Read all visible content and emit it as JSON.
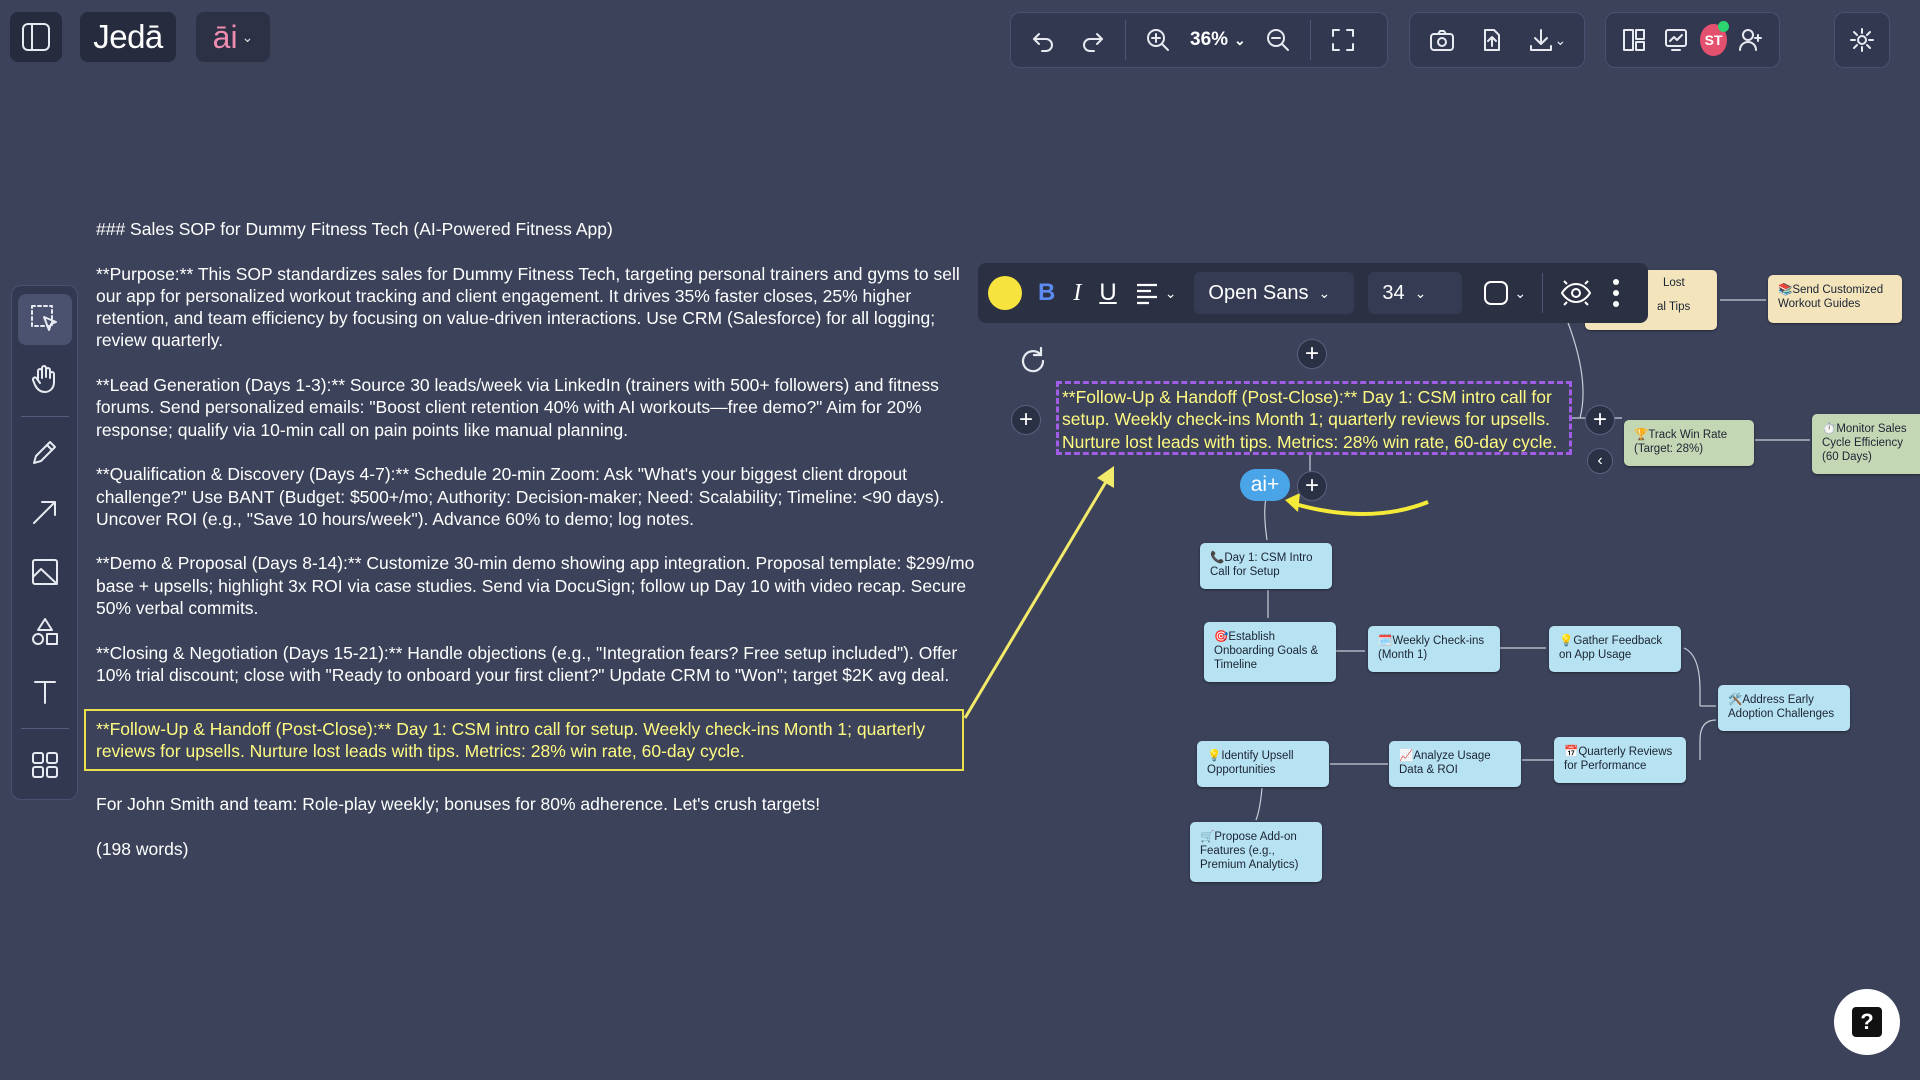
{
  "app": {
    "brand": "Jedā",
    "ai_label": "āi"
  },
  "toolbar": {
    "zoom": "36%",
    "avatar_initials": "ST"
  },
  "format_bar": {
    "color": "#f7e33e",
    "bold": "B",
    "italic": "I",
    "underline": "U",
    "font": "Open Sans",
    "size": "34"
  },
  "document": {
    "paragraphs": [
      "### Sales SOP for Dummy Fitness Tech (AI-Powered Fitness App)",
      "**Purpose:** This SOP standardizes sales for Dummy Fitness Tech, targeting personal trainers and gyms to sell our app for personalized workout tracking and client engagement. It drives 35% faster closes, 25% higher retention, and team efficiency by focusing on value-driven interactions. Use CRM (Salesforce) for all logging; review quarterly.",
      "**Lead Generation (Days 1-3):** Source 30 leads/week via LinkedIn (trainers with 500+ followers) and fitness forums. Send personalized emails: \"Boost client retention 40% with AI workouts—free demo?\" Aim for 20% response; qualify via 10-min call on pain points like manual planning.",
      "**Qualification & Discovery (Days 4-7):** Schedule 20-min Zoom: Ask \"What's your biggest client dropout challenge?\" Use BANT (Budget: $500+/mo; Authority: Decision-maker; Need: Scalability; Timeline: <90 days). Uncover ROI (e.g., \"Save 10 hours/week\"). Advance 60% to demo; log notes.",
      "**Demo & Proposal (Days 8-14):** Customize 30-min demo showing app integration. Proposal template: $299/mo base + upsells; highlight 3x ROI via case studies. Send via DocuSign; follow up Day 10 with video recap. Secure 50% verbal commits.",
      "**Closing & Negotiation (Days 15-21):** Handle objections (e.g., \"Integration fears? Free setup included\"). Offer 10% trial discount; close with \"Ready to onboard your first client?\" Update CRM to \"Won\"; target $2K avg deal.",
      "**Follow-Up & Handoff (Post-Close):** Day 1: CSM intro call for setup. Weekly check-ins Month 1; quarterly reviews for upsells. Nurture lost leads with tips. Metrics: 28% win rate, 60-day cycle.",
      "For John Smith and team: Role-play weekly; bonuses for 80% adherence. Let's crush targets!",
      "(198 words)"
    ]
  },
  "canvas": {
    "selected_text": "**Follow-Up & Handoff (Post-Close):** Day 1: CSM intro call for setup. Weekly check-ins Month 1; quarterly reviews for upsells. Nurture lost leads with tips. Metrics: 28% win rate, 60-day cycle.",
    "ai_button": "ai+",
    "nodes": {
      "lost_a": "Lost",
      "lost_b": "al Tips",
      "send_guides": "📚Send Customized Workout Guides",
      "track_win": "🏆Track Win Rate (Target: 28%)",
      "monitor": "⏱️Monitor Sales Cycle Efficiency (60 Days)",
      "day1": "📞Day 1: CSM Intro Call for Setup",
      "establish": "🎯Establish Onboarding Goals & Timeline",
      "weekly": "🗓️Weekly Check-ins (Month 1)",
      "feedback": "💡Gather Feedback on App Usage",
      "address": "🛠️Address Early Adoption Challenges",
      "quarterly": "📅Quarterly Reviews for Performance",
      "analyze": "📈Analyze Usage Data & ROI",
      "upsell": "💡Identify Upsell Opportunities",
      "propose": "🛒Propose Add-on Features (e.g., Premium Analytics)"
    }
  },
  "help": {
    "label": "?"
  }
}
